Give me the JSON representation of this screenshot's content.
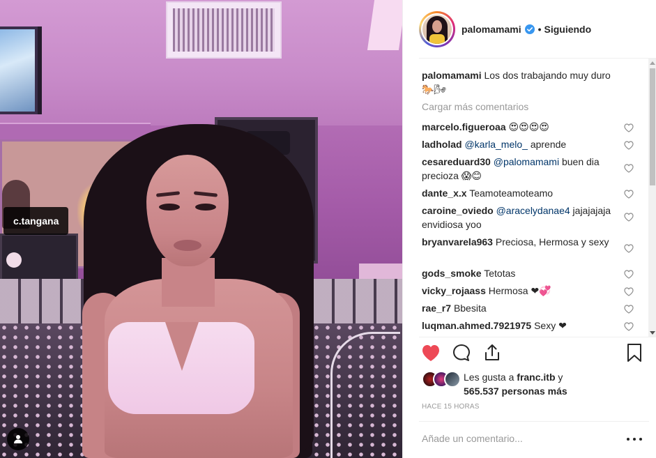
{
  "photo": {
    "tag_label": "c.tangana"
  },
  "header": {
    "username": "palomamami",
    "separator": "•",
    "follow_status": "Siguiendo"
  },
  "caption": {
    "username": "palomamami",
    "text": "Los dos trabajando muy duro",
    "emoji": "🐎🌬"
  },
  "load_more": "Cargar más comentarios",
  "comments": [
    {
      "user": "marcelo.figueroaa",
      "text": "",
      "emoji": "😍😍😍😍"
    },
    {
      "user": "ladholad",
      "mention": "@karla_melo_",
      "text": " aprende",
      "emoji": ""
    },
    {
      "user": "cesareduard30",
      "mention": "@palomamami",
      "text": " buen dia precioza",
      "emoji": "😱😊"
    },
    {
      "user": "dante_x.x",
      "text": "Teamoteamoteamo",
      "emoji": ""
    },
    {
      "user": "caroine_oviedo",
      "mention": "@aracelydanae4",
      "text": " jajajajaja envidiosa yoo",
      "emoji": ""
    },
    {
      "user": "bryanvarela963",
      "text": "Preciosa, Hermosa y sexy",
      "emoji": ""
    },
    {
      "user": "gods_smoke",
      "text": "Tetotas",
      "emoji": ""
    },
    {
      "user": "vicky_rojaass",
      "text": "Hermosa",
      "emoji": "❤💞"
    },
    {
      "user": "rae_r7",
      "text": "Bbesita",
      "emoji": ""
    },
    {
      "user": "luqman.ahmed.7921975",
      "text": "Sexy",
      "emoji": "❤"
    }
  ],
  "likes": {
    "prefix": "Les gusta a",
    "user": "franc.itb",
    "connector": "y",
    "count": "565.537 personas más"
  },
  "timestamp": "HACE 15 HORAS",
  "add_comment_placeholder": "Añade un comentario...",
  "colors": {
    "like_red": "#ed4956",
    "verified_blue": "#3897f0",
    "mention_blue": "#003569",
    "muted_gray": "#999999"
  },
  "icons": {
    "like": "heart-filled-icon",
    "comment": "speech-bubble-icon",
    "share": "share-upload-icon",
    "save": "bookmark-icon",
    "comment_like": "heart-outline-icon",
    "verified": "verified-badge-icon",
    "more": "ellipsis-icon",
    "user_tags": "person-icon"
  }
}
